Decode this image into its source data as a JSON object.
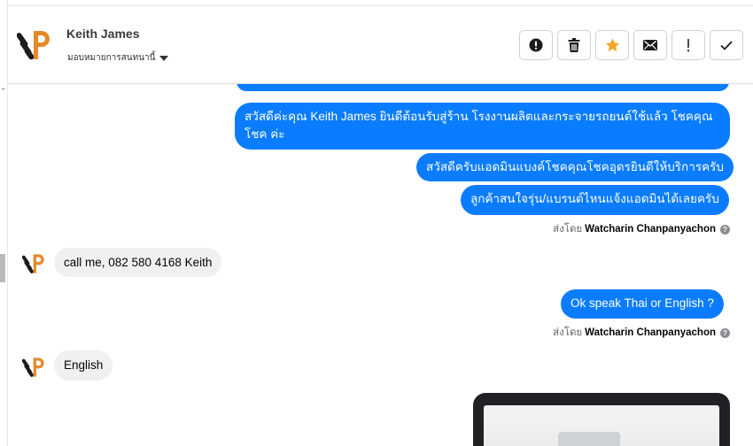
{
  "header": {
    "contact_name": "Keith James",
    "assign_label": "มอบหมายการสนทนานี้",
    "actions": [
      {
        "icon": "alert-circle-icon",
        "name": "mark-spam-button"
      },
      {
        "icon": "trash-icon",
        "name": "delete-button"
      },
      {
        "icon": "star-icon",
        "name": "star-button"
      },
      {
        "icon": "envelope-icon",
        "name": "mark-unread-button"
      },
      {
        "icon": "exclamation-icon",
        "name": "follow-up-button"
      },
      {
        "icon": "check-icon",
        "name": "done-button"
      }
    ]
  },
  "messages": {
    "out_1": "สวัสดีค่ะคุณ Keith James ยินดีต้อนรับสู่ร้าน โรงงานผลิตและกระจายรถยนต์ใช้แล้ว โชคคุณ",
    "out_1_line2": "โชค ค่ะ",
    "out_2": "สวัสดีครับแอดมินแบงค์โชคคุณโชคอุดรยินดีให้บริการครับ",
    "out_3": "ลูกค้าสนใจรุ่น/แบรนด์ไหนแจ้งแอดมินได้เลยครับ",
    "sent_by_prefix": "ส่งโดย",
    "sent_by_agent": "Watcharin Chanpanyachon",
    "in_1": "call me, 082 580 4168 Keith",
    "out_4": "Ok speak Thai or  English ?",
    "in_2": "English"
  },
  "colors": {
    "outgoing_bubble": "#0a7cff",
    "incoming_bubble": "#f0f0f0",
    "star_accent": "#f5a623",
    "brand_orange": "#e58a2b"
  }
}
